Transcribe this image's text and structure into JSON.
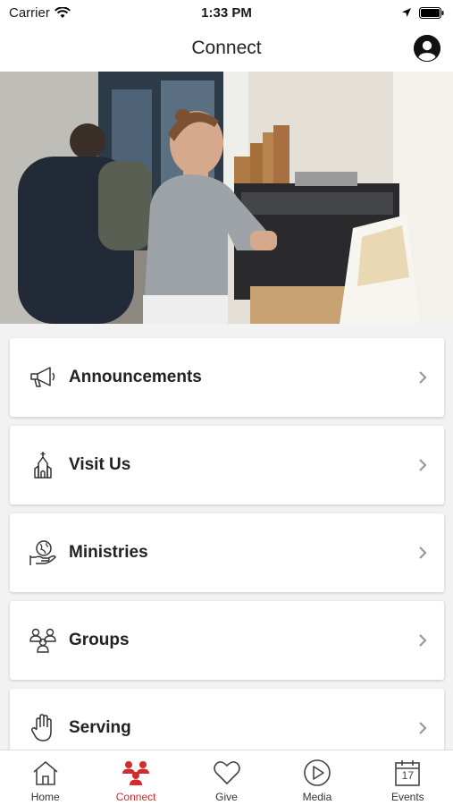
{
  "status_bar": {
    "carrier": "Carrier",
    "time": "1:33 PM"
  },
  "nav": {
    "title": "Connect"
  },
  "hero": {
    "description_icon": "hero-photo"
  },
  "menu": [
    {
      "label": "Announcements",
      "icon": "megaphone-icon"
    },
    {
      "label": "Visit Us",
      "icon": "church-icon"
    },
    {
      "label": "Ministries",
      "icon": "globe-hand-icon"
    },
    {
      "label": "Groups",
      "icon": "people-icon"
    },
    {
      "label": "Serving",
      "icon": "hand-icon"
    }
  ],
  "tabs": [
    {
      "label": "Home",
      "icon": "home-icon"
    },
    {
      "label": "Connect",
      "icon": "connect-icon",
      "active": true
    },
    {
      "label": "Give",
      "icon": "heart-icon"
    },
    {
      "label": "Media",
      "icon": "play-icon"
    },
    {
      "label": "Events",
      "icon": "calendar-icon",
      "calendar_day": "17"
    }
  ],
  "colors": {
    "accent": "#d22b2b",
    "background": "#f2f2f2"
  }
}
